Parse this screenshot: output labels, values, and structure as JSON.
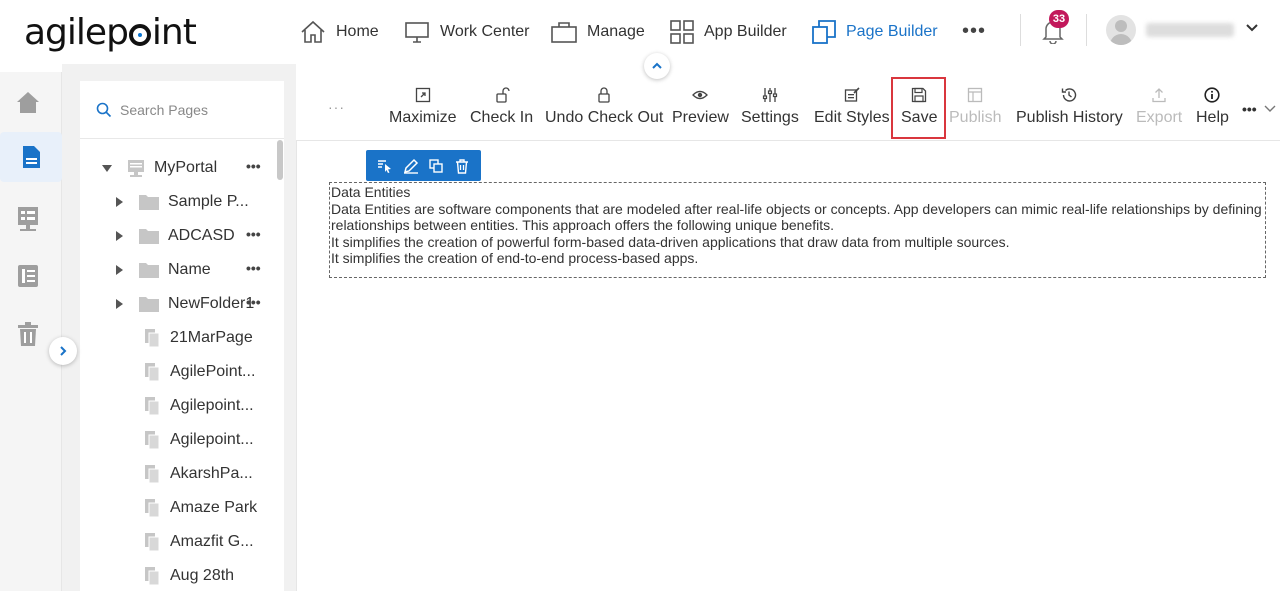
{
  "brand": {
    "logo_text_left": "agilep",
    "logo_text_right": "int"
  },
  "nav": {
    "items": [
      {
        "label": "Home",
        "icon": "home-icon"
      },
      {
        "label": "Work Center",
        "icon": "monitor-icon"
      },
      {
        "label": "Manage",
        "icon": "briefcase-icon"
      },
      {
        "label": "App Builder",
        "icon": "grid-icon"
      },
      {
        "label": "Page Builder",
        "icon": "copy-icon",
        "active": true
      }
    ],
    "more": "•••",
    "notification_count": "33"
  },
  "sidebar_tree": {
    "search_placeholder": "Search Pages",
    "root": {
      "label": "MyPortal"
    },
    "items": [
      {
        "label": "Sample P...",
        "type": "folder"
      },
      {
        "label": "ADCASD",
        "type": "folder"
      },
      {
        "label": "Name",
        "type": "folder"
      },
      {
        "label": "NewFolder1",
        "type": "folder"
      },
      {
        "label": "21MarPage",
        "type": "page"
      },
      {
        "label": "AgilePoint...",
        "type": "page"
      },
      {
        "label": "Agilepoint...",
        "type": "page"
      },
      {
        "label": "Agilepoint...",
        "type": "page"
      },
      {
        "label": "AkarshPa...",
        "type": "page"
      },
      {
        "label": "Amaze Park",
        "type": "page"
      },
      {
        "label": "Amazfit G...",
        "type": "page"
      },
      {
        "label": "Aug 28th",
        "type": "page"
      }
    ],
    "dots": "•••"
  },
  "toolbar": {
    "leading": "···",
    "maximize": "Maximize",
    "check_in": "Check In",
    "undo_check_out": "Undo Check Out",
    "preview": "Preview",
    "settings": "Settings",
    "edit_styles": "Edit Styles",
    "save": "Save",
    "publish": "Publish",
    "publish_history": "Publish History",
    "export": "Export",
    "help": "Help",
    "more": "•••"
  },
  "content": {
    "title": "Data Entities",
    "paragraph": "Data Entities are software components that are modeled after real-life objects or concepts. App developers can mimic real-life relationships by defining relationships between entities. This approach offers the following unique benefits.",
    "benefit_1": "It simplifies the creation of powerful form-based data-driven applications that draw data from multiple sources.",
    "benefit_2": "It simplifies the creation of end-to-end process-based apps."
  },
  "colors": {
    "accent": "#1a73c8",
    "highlight": "#d9363e",
    "badge": "#c2185b"
  }
}
